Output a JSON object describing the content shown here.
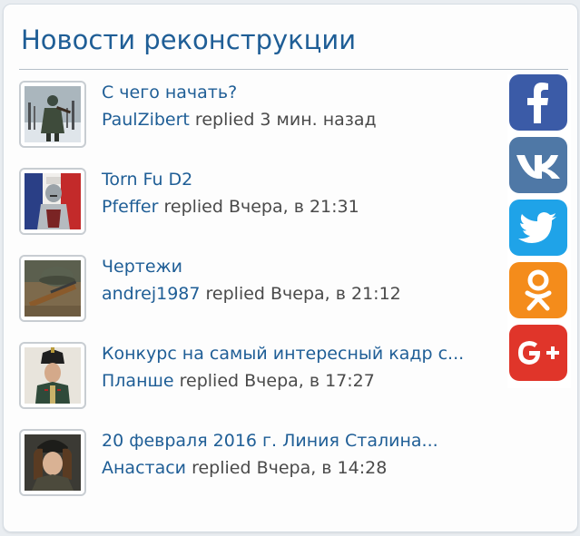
{
  "widget": {
    "title": "Новости реконструкции",
    "replied_word": "replied"
  },
  "threads": [
    {
      "title": "С чего начать?",
      "user": "PaulZibert",
      "time": "3 мин. назад",
      "avatar": "soldier-winter-icon"
    },
    {
      "title": "Torn Fu D2",
      "user": "Pfeffer",
      "time": "Вчера, в 21:31",
      "avatar": "knight-flag-icon"
    },
    {
      "title": "Чертежи",
      "user": "andrej1987",
      "time": "Вчера, в 21:12",
      "avatar": "rifle-helmet-icon"
    },
    {
      "title": "Конкурс на самый интересный кадр с...",
      "user": "Планше",
      "time": "Вчера, в 17:27",
      "avatar": "officer-portrait-icon"
    },
    {
      "title": "20 февраля 2016 г. Линия Сталина...",
      "user": "Анастаси",
      "time": "Вчера, в 14:28",
      "avatar": "girl-portrait-icon"
    }
  ],
  "social": [
    {
      "name": "facebook-icon",
      "color": "#3b5ba7"
    },
    {
      "name": "vk-icon",
      "color": "#4f78a6"
    },
    {
      "name": "twitter-icon",
      "color": "#1fa3e8"
    },
    {
      "name": "odnoklassniki-icon",
      "color": "#f48c1b"
    },
    {
      "name": "google-plus-icon",
      "color": "#e0352a"
    }
  ],
  "colors": {
    "link": "#1f5e96",
    "text": "#4a4a4a",
    "panel_bg": "#fdfdfd"
  }
}
